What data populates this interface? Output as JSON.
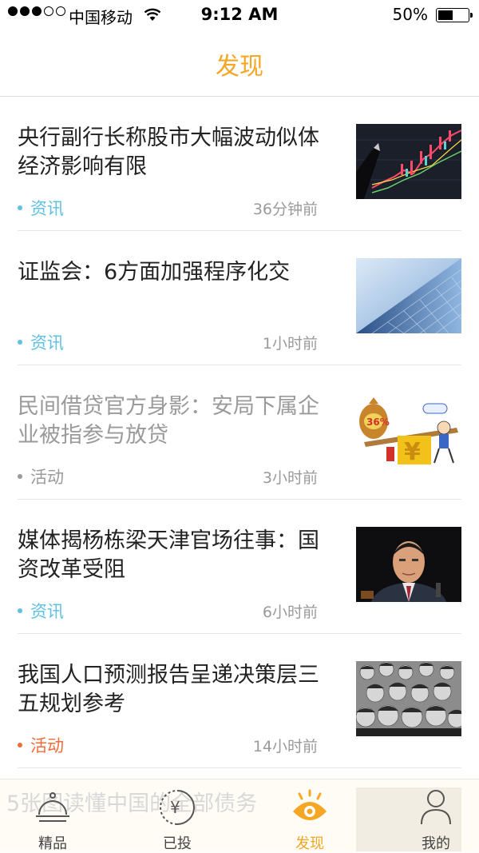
{
  "status_bar": {
    "carrier": "中国移动",
    "time": "9:12 AM",
    "battery": "50%"
  },
  "nav": {
    "title": "发现"
  },
  "colors": {
    "accent": "#f5a623",
    "tag_news": "#5fc0e4",
    "tag_event_gray": "#9a9a9a",
    "tag_event_orange": "#f26b3a"
  },
  "feed": [
    {
      "headline": "央行副行长称股市大幅波动似体经济影响有限",
      "tag": "资讯",
      "tag_style": "news",
      "time": "36分钟前",
      "thumb": "stock-chart-image",
      "faded": false
    },
    {
      "headline": "证监会：6方面加强程序化交",
      "tag": "资讯",
      "tag_style": "news",
      "time": "1小时前",
      "thumb": "skyscraper-image",
      "faded": false
    },
    {
      "headline": "民间借贷官方身影：安局下属企业被指参与放贷",
      "tag": "活动",
      "tag_style": "event-gray",
      "time": "3小时前",
      "thumb": "loan-cartoon-image",
      "faded": true
    },
    {
      "headline": "媒体揭杨栋梁天津官场往事：国资改革受阻",
      "tag": "资讯",
      "tag_style": "news",
      "time": "6小时前",
      "thumb": "portrait-image",
      "faded": false
    },
    {
      "headline": "我国人口预测报告呈递决策层三五规划参考",
      "tag": "活动",
      "tag_style": "event-orange",
      "time": "14小时前",
      "thumb": "crowd-image",
      "faded": false
    }
  ],
  "tabbar": {
    "ghost_text": "5张图读懂中国的全部债务",
    "tabs": [
      {
        "label": "精品",
        "icon": "bell-tray-icon"
      },
      {
        "label": "已投",
        "icon": "yen-coin-icon"
      },
      {
        "label": "发现",
        "icon": "eye-icon",
        "active": true
      },
      {
        "label": "我的",
        "icon": "person-icon"
      }
    ]
  }
}
